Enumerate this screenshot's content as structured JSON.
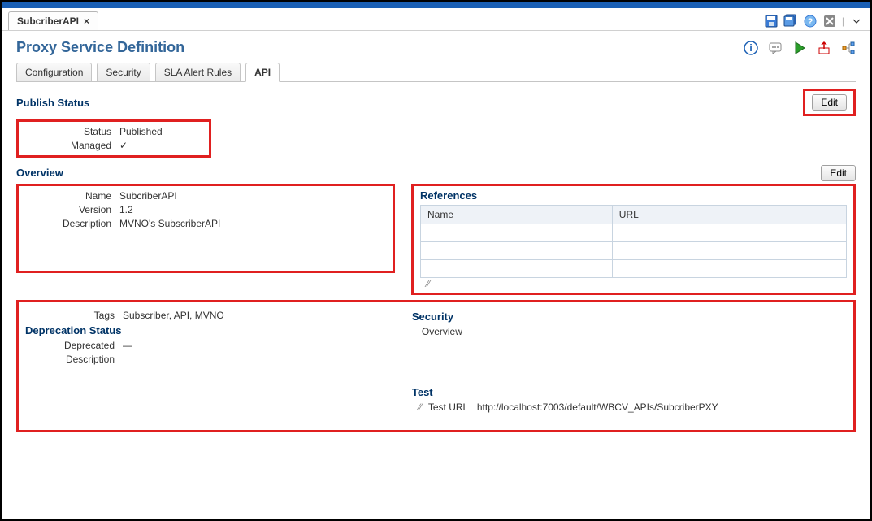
{
  "tab": {
    "title": "SubcriberAPI"
  },
  "page": {
    "title": "Proxy Service Definition"
  },
  "subtabs": {
    "configuration": "Configuration",
    "security": "Security",
    "sla": "SLA Alert Rules",
    "api": "API"
  },
  "buttons": {
    "edit": "Edit"
  },
  "publishStatus": {
    "header": "Publish Status",
    "statusLabel": "Status",
    "statusValue": "Published",
    "managedLabel": "Managed",
    "managedValue": "✓"
  },
  "overview": {
    "header": "Overview",
    "nameLabel": "Name",
    "nameValue": "SubcriberAPI",
    "versionLabel": "Version",
    "versionValue": "1.2",
    "descriptionLabel": "Description",
    "descriptionValue": "MVNO's SubscriberAPI",
    "tagsLabel": "Tags",
    "tagsValue": "Subscriber, API, MVNO"
  },
  "references": {
    "header": "References",
    "nameCol": "Name",
    "urlCol": "URL"
  },
  "security": {
    "header": "Security",
    "overview": "Overview"
  },
  "deprecation": {
    "header": "Deprecation Status",
    "deprecatedLabel": "Deprecated",
    "deprecatedValue": "—",
    "descriptionLabel": "Description"
  },
  "test": {
    "header": "Test",
    "urlLabel": "Test URL",
    "urlValue": "http://localhost:7003/default/WBCV_APIs/SubcriberPXY"
  }
}
